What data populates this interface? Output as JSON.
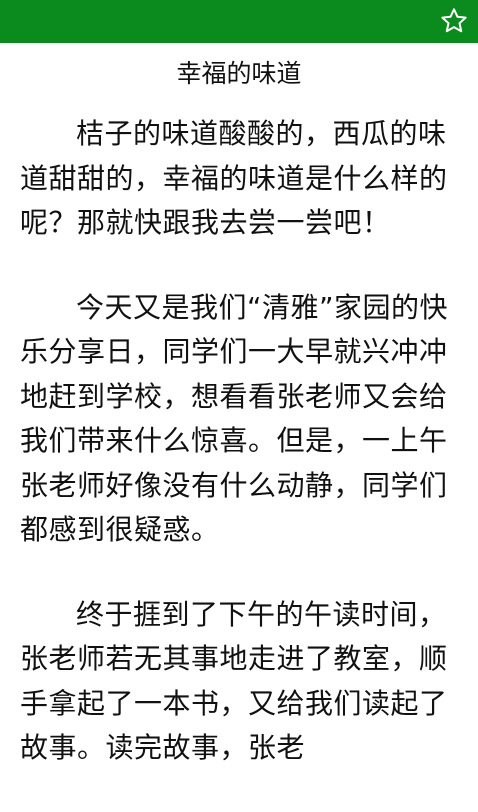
{
  "header": {
    "star_icon": "star-outline-icon",
    "bar_color": "#0b8a1e"
  },
  "article": {
    "title": "幸福的味道",
    "paragraphs": [
      "桔子的味道酸酸的，西瓜的味道甜甜的，幸福的味道是什么样的呢？那就快跟我去尝一尝吧！",
      "今天又是我们“清雅”家园的快乐分享日，同学们一大早就兴冲冲地赶到学校，想看看张老师又会给我们带来什么惊喜。但是，一上午张老师好像没有什么动静，同学们都感到很疑惑。",
      "终于捱到了下午的午读时间，张老师若无其事地走进了教室，顺手拿起了一本书，又给我们读起了故事。读完故事，张老"
    ]
  }
}
